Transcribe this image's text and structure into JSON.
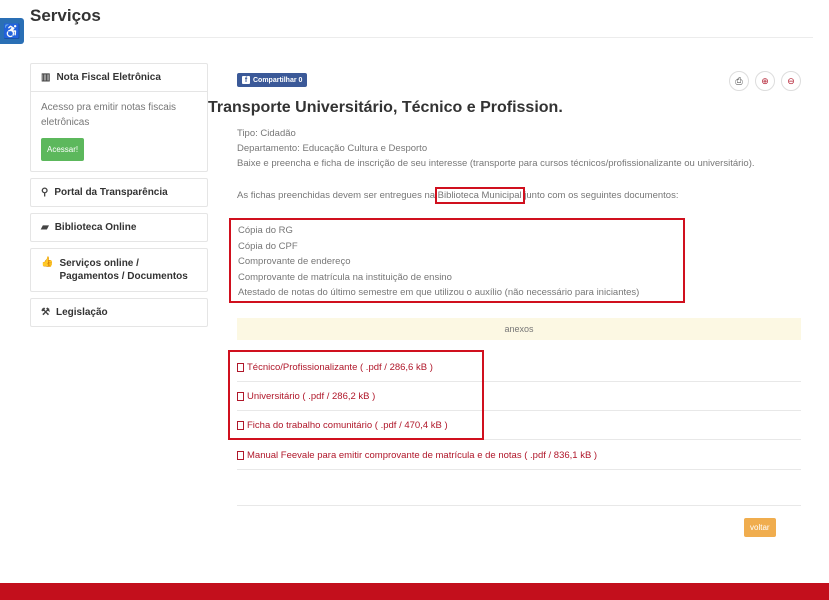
{
  "header": {
    "title": "Serviços",
    "accessibility_icon": "accessibility-icon"
  },
  "sidebar": {
    "nfe": {
      "title": "Nota Fiscal Eletrônica",
      "text": "Acesso pra emitir notas fiscais eletrônicas",
      "button": "Acessar!"
    },
    "items": [
      {
        "label": "Portal da Transparência",
        "icon": "search-icon"
      },
      {
        "label": "Biblioteca Online",
        "icon": "book-icon"
      },
      {
        "label": "Serviços online / Pagamentos / Documentos",
        "icon": "thumbs-up-icon"
      },
      {
        "label": "Legislação",
        "icon": "gavel-icon"
      }
    ]
  },
  "toolbar": {
    "share_label": "Compartilhar 0",
    "print_icon": "print-icon",
    "zoom_in_icon": "zoom-in-icon",
    "zoom_out_icon": "zoom-out-icon"
  },
  "service": {
    "title": "Transporte Universitário, Técnico e Profission.",
    "tipo": "Tipo: Cidadão",
    "departamento": "Departamento: Educação Cultura e Desporto",
    "descricao": "Baixe e preencha e ficha de inscrição de seu interesse (transporte para cursos técnicos/profissionalizante ou universitário).",
    "entrega_prefix": "As fichas preenchidas devem ser entregues na ",
    "entrega_highlight": "Biblioteca Municipal",
    "entrega_suffix": " junto com os seguintes documentos:",
    "documentos": [
      "Cópia do RG",
      "Cópia do CPF",
      "Comprovante de endereço",
      "Comprovante de matrícula na instituição de ensino",
      "Atestado de notas do último semestre em que utilizou o auxílio (não necessário para iniciantes)"
    ]
  },
  "anexos": {
    "label": "anexos",
    "files": [
      "Técnico/Profissionalizante ( .pdf / 286,6 kB )",
      "Universitário ( .pdf / 286,2 kB )",
      "Ficha do trabalho comunitário ( .pdf / 470,4 kB )",
      "Manual Feevale para emitir comprovante de matrícula e de notas ( .pdf / 836,1 kB )"
    ]
  },
  "actions": {
    "voltar": "voltar"
  },
  "colors": {
    "accent": "#b0172a",
    "footer": "#c30f1c",
    "highlight": "#d0101e",
    "success": "#5cb85c",
    "warning": "#f0ad4e",
    "facebook": "#3b5998"
  }
}
